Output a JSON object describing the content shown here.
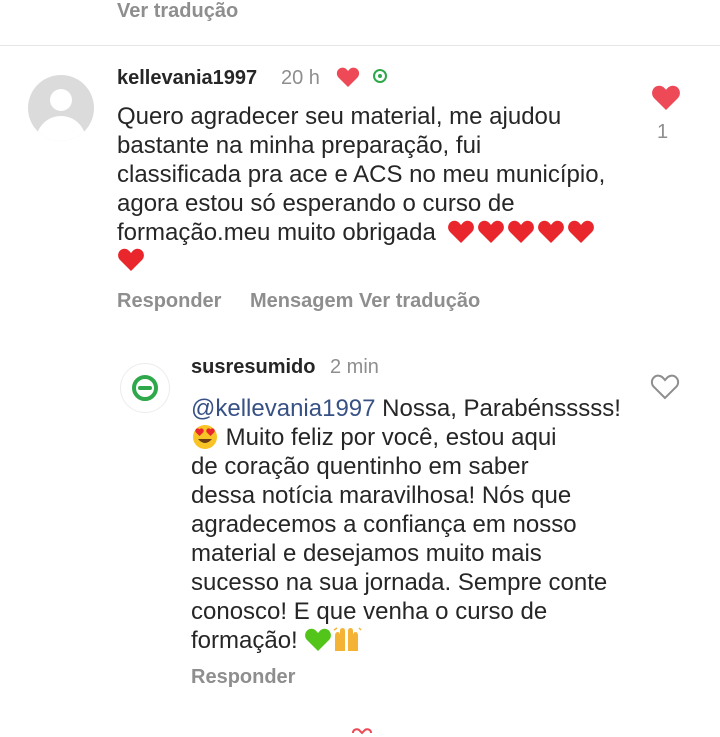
{
  "top": {
    "translate_label": "Ver tradução"
  },
  "comment": {
    "username": "kellevania1997",
    "time": "20 h",
    "text_lines": [
      "Quero agradecer seu material, me ajudou",
      "bastante na minha preparação, fui",
      "classificada pra ace e ACS no meu município,",
      "agora estou só esperando o curso de",
      "formação.meu muito obrigada"
    ],
    "emoji_hearts_count": 6,
    "like_count": "1",
    "actions": {
      "reply": "Responder",
      "message": "Mensagem",
      "translate": "Ver tradução"
    }
  },
  "reply": {
    "username": "susresumido",
    "time": "2 min",
    "mention": "@kellevania1997",
    "text_lines": [
      " Nossa, Parabénsssss!",
      " Muito feliz por você, estou aqui",
      "de coração quentinho em saber",
      "dessa notícia maravilhosa! Nós que",
      "agradecemos a confiança em nosso",
      "material e desejamos muito mais",
      "sucesso na sua jornada. Sempre conte",
      "conosco! E que venha o curso de",
      "formação! "
    ],
    "emojis": {
      "heart_eyes": "😍",
      "green_heart": "💚",
      "raised_hands": "🙌"
    },
    "actions": {
      "reply": "Responder"
    }
  },
  "colors": {
    "like_red": "#ed4956",
    "brand_green": "#2ea84a",
    "muted_text": "#8e8e8e"
  }
}
